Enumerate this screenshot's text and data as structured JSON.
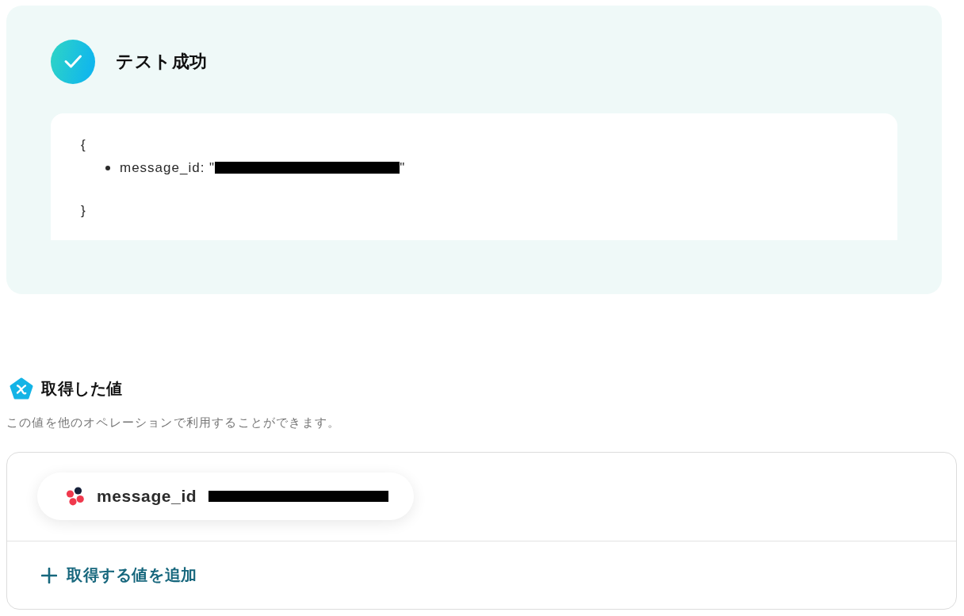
{
  "result": {
    "kind": "success",
    "title": "テスト成功",
    "output": {
      "open_brace": "{",
      "items": [
        {
          "text_before": "message_id: \"",
          "redacted": true,
          "text_after": "\""
        }
      ],
      "close_brace": "}"
    }
  },
  "values_section": {
    "title": "取得した値",
    "description": "この値を他のオペレーションで利用することができます。",
    "values": [
      {
        "name": "message_id",
        "redacted": true
      }
    ],
    "add_button": "取得する値を追加"
  }
}
